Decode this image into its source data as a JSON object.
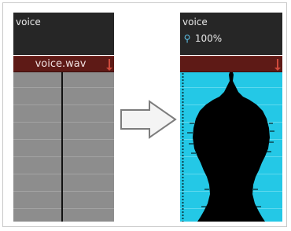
{
  "left_panel": {
    "layer_name": "voice",
    "clip_name": "voice.wav"
  },
  "right_panel": {
    "layer_name": "voice",
    "zoom": "100%",
    "zoom_icon": "magnifier-icon"
  },
  "transition_icon": "right-arrow-icon",
  "colors": {
    "header_bg": "#262626",
    "clip_bar": "#5e1a16",
    "track_gray": "#8d8d8d",
    "track_cyan": "#24c8e6",
    "marker": "#cf4a3c"
  }
}
